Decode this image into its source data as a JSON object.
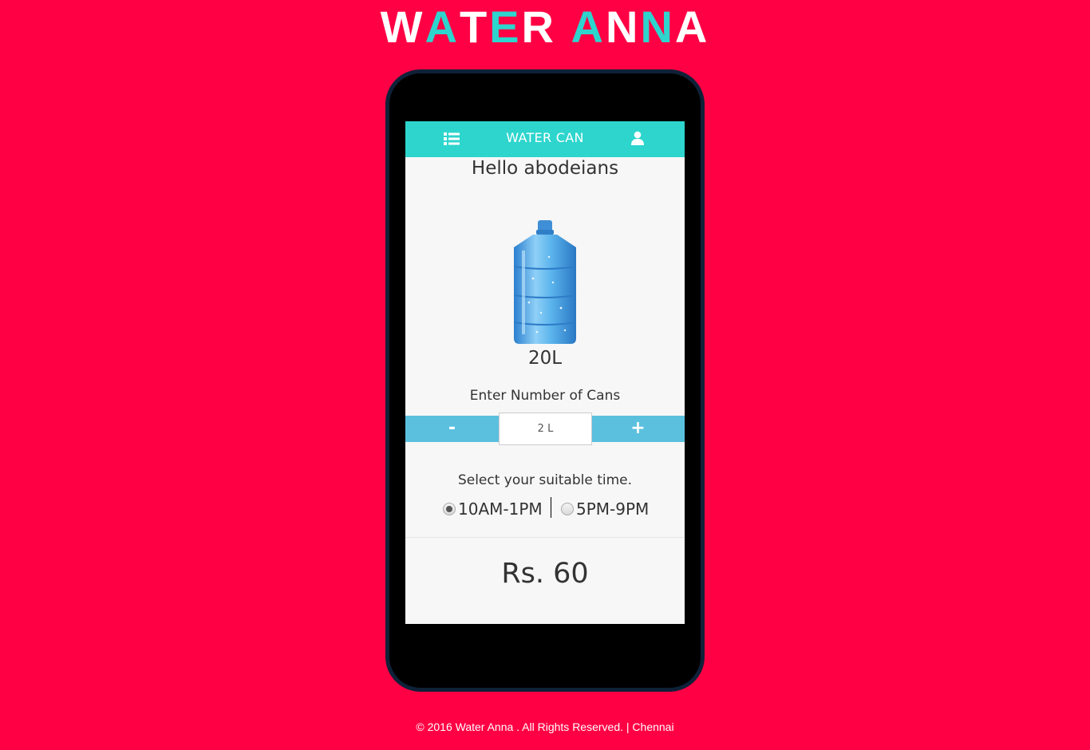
{
  "brand": {
    "letters": [
      {
        "char": "W",
        "color": "#ffffff"
      },
      {
        "char": "A",
        "color": "#2dd5cd"
      },
      {
        "char": "T",
        "color": "#ffffff"
      },
      {
        "char": "E",
        "color": "#2dd5cd"
      },
      {
        "char": "R",
        "color": "#ffffff"
      },
      {
        "char": " ",
        "color": "#ffffff"
      },
      {
        "char": "A",
        "color": "#2dd5cd"
      },
      {
        "char": "N",
        "color": "#ffffff"
      },
      {
        "char": "N",
        "color": "#2dd5cd"
      },
      {
        "char": "A",
        "color": "#ffffff"
      }
    ]
  },
  "topbar": {
    "title": "WATER CAN",
    "left_icon": "list-icon",
    "right_icon": "user-icon"
  },
  "main": {
    "greeting": "Hello abodeians",
    "product_image": "water-can-bottle",
    "size": "20L",
    "cans_label": "Enter Number of Cans",
    "minus_label": "-",
    "plus_label": "+",
    "quantity_value": "2 L",
    "time_label": "Select your suitable time.",
    "time_options": [
      {
        "label": "10AM-1PM",
        "selected": true
      },
      {
        "label": "5PM-9PM",
        "selected": false
      }
    ],
    "price": "Rs. 60"
  },
  "footer": {
    "text": "© 2016 Water Anna . All Rights Reserved. | Chennai"
  },
  "colors": {
    "page_background": "#ff0044",
    "accent": "#2dd5cd",
    "stepper": "#5bc0de",
    "phone_body": "#000000",
    "phone_border": "#0f2138"
  }
}
